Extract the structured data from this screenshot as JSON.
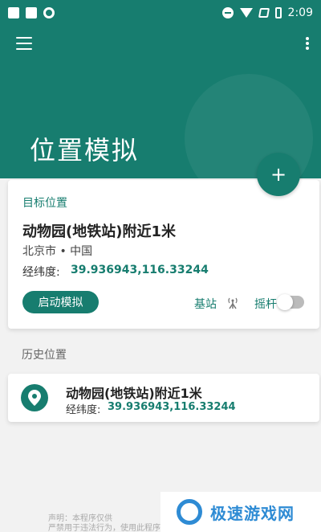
{
  "status_bar": {
    "time": "2:09"
  },
  "app": {
    "title": "位置模拟",
    "fab_label": "+"
  },
  "target": {
    "section_title": "目标位置",
    "place": "动物园(地铁站)附近1米",
    "city": "北京市 • 中国",
    "coord_label": "经纬度:",
    "coord_value": "39.936943,116.33244",
    "start_button": "启动模拟",
    "base_station_label": "基站",
    "joystick_label": "摇杆"
  },
  "history": {
    "title": "历史位置",
    "items": [
      {
        "place": "动物园(地铁站)附近1米",
        "coord_label": "经纬度:",
        "coord_value": "39.936943,116.33244"
      }
    ]
  },
  "footer": {
    "line1": "声明：本程序仅供",
    "line2": "严禁用于违法行为，使用此程序所"
  },
  "watermark": {
    "text": "极速游戏网"
  },
  "colors": {
    "primary": "#177d6f",
    "background": "#f2f2f2"
  },
  "icons": [
    "menu-icon",
    "more-vert-icon",
    "add-icon",
    "antenna-icon",
    "location-pin-icon"
  ]
}
